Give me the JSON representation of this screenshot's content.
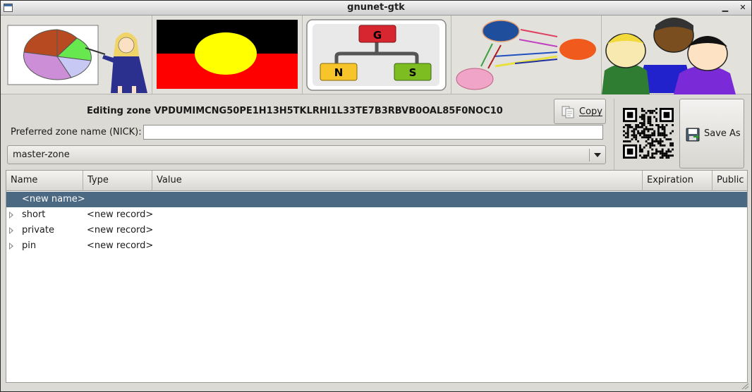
{
  "window": {
    "title": "gnunet-gtk"
  },
  "titlebar": {
    "icons": [
      "app-menu-icon",
      "minimize-icon",
      "close-icon"
    ]
  },
  "banner": {
    "tiles": [
      "statistics-presenter-icon",
      "flag-image",
      "gns-logo-icon",
      "peers-graph-icon",
      "users-group-icon"
    ]
  },
  "zone": {
    "editing_label": "Editing zone VPDUMIMCNG50PE1H13H5TKLRHI1L33TE7B3RBVB0OAL85F0NOC10",
    "copy_label": "Copy",
    "copy_underline": "C",
    "nick_label": "Preferred zone name (NICK):",
    "nick_value": "",
    "nick_placeholder": "",
    "selected_zone": "master-zone",
    "save_as_label": "Save As",
    "save_as_underline": "A"
  },
  "tree": {
    "columns": [
      "Name",
      "Type",
      "Value",
      "Expiration",
      "Public"
    ],
    "rows": [
      {
        "name": "<new name>",
        "type": "",
        "selected": true,
        "expander": false
      },
      {
        "name": "short",
        "type": "<new record>",
        "selected": false,
        "expander": true
      },
      {
        "name": "private",
        "type": "<new record>",
        "selected": false,
        "expander": true
      },
      {
        "name": "pin",
        "type": "<new record>",
        "selected": false,
        "expander": true
      }
    ]
  },
  "colors": {
    "window_bg": "#dcdad5",
    "selection": "#4b6983",
    "gns_g": "#d7262f",
    "gns_n": "#f7c52a",
    "gns_s": "#7dbd22"
  }
}
